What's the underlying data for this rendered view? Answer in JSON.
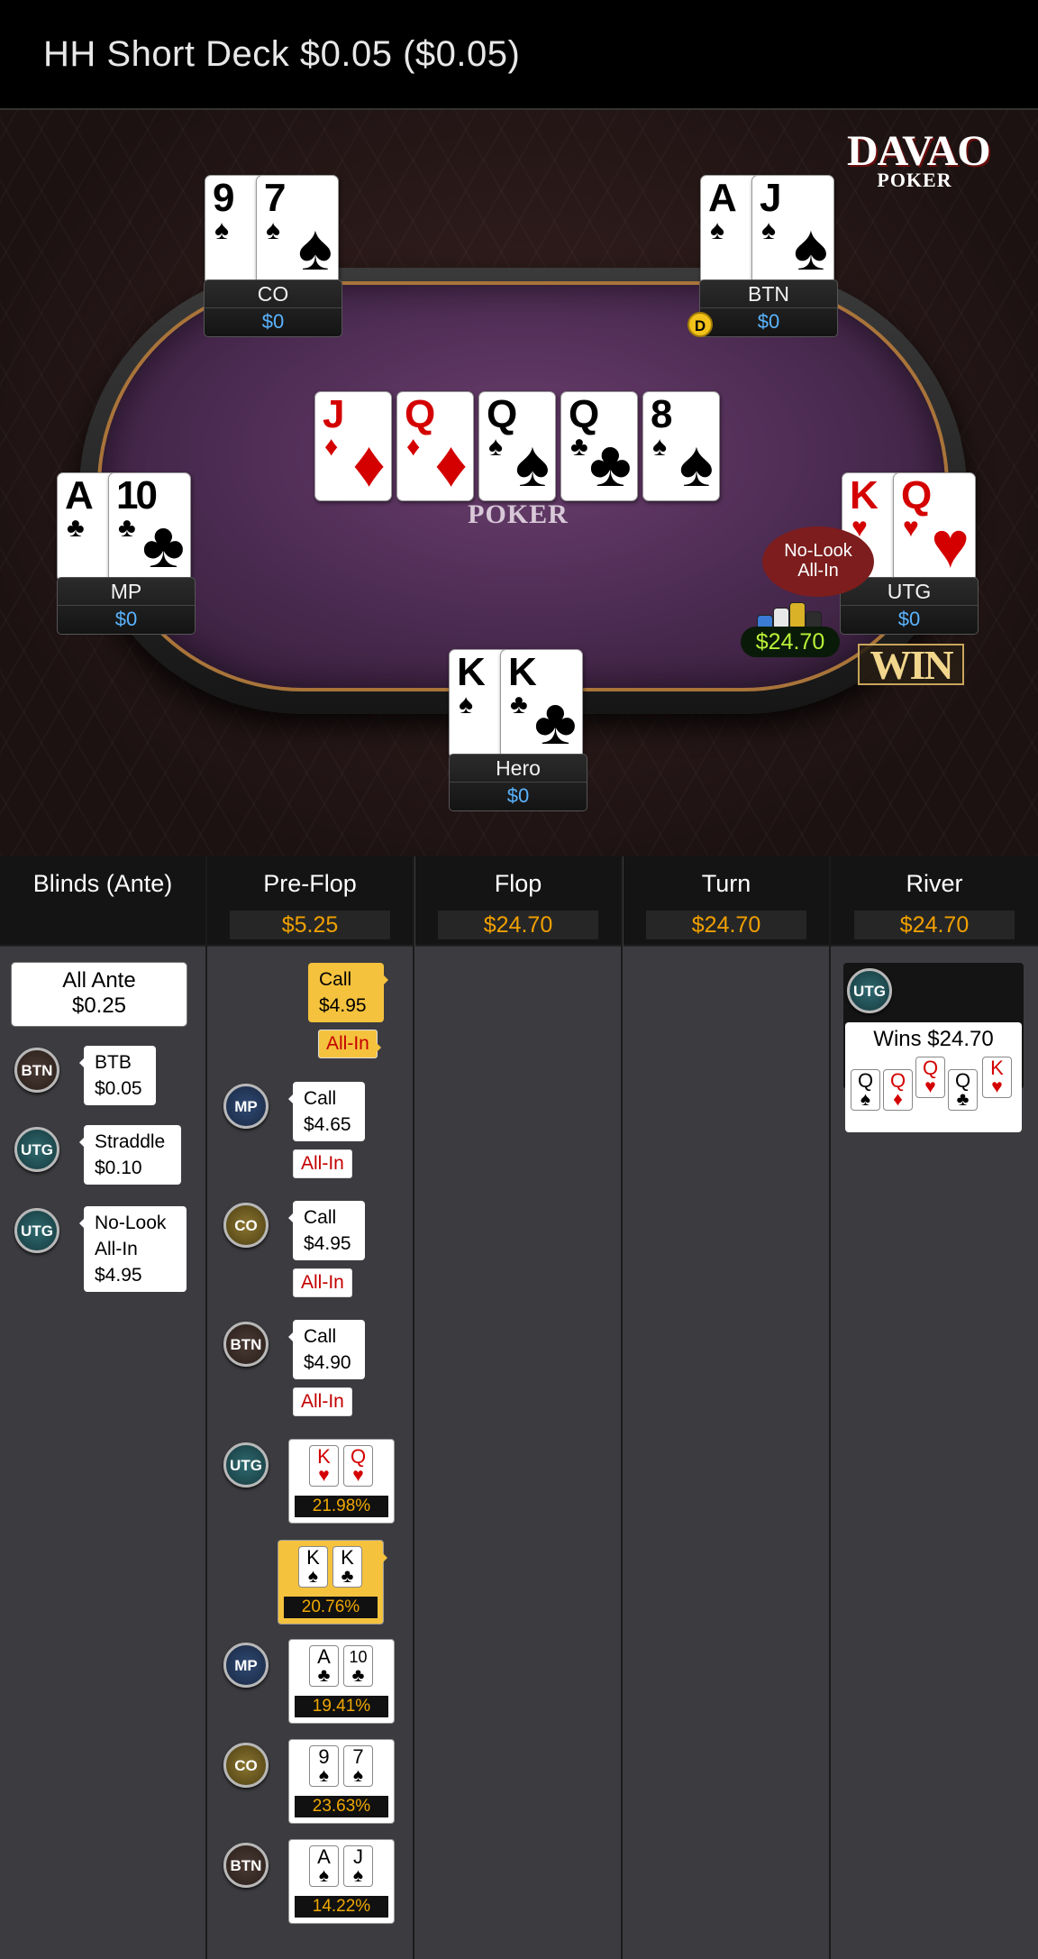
{
  "header": {
    "title": "HH  Short Deck $0.05 ($0.05)"
  },
  "brand": {
    "logo_main": "DAVAO",
    "logo_sub": "POKER",
    "felt_logo": "POKER"
  },
  "seats": {
    "co": {
      "name": "CO",
      "stack": "$0",
      "cards": [
        {
          "rank": "9",
          "suit": "♠"
        },
        {
          "rank": "7",
          "suit": "♠"
        }
      ]
    },
    "btn": {
      "name": "BTN",
      "stack": "$0",
      "dealer": "D",
      "cards": [
        {
          "rank": "A",
          "suit": "♠"
        },
        {
          "rank": "J",
          "suit": "♠"
        }
      ]
    },
    "mp": {
      "name": "MP",
      "stack": "$0",
      "cards": [
        {
          "rank": "A",
          "suit": "♣"
        },
        {
          "rank": "10",
          "suit": "♣"
        }
      ]
    },
    "utg": {
      "name": "UTG",
      "stack": "$0",
      "cards": [
        {
          "rank": "K",
          "suit": "♥"
        },
        {
          "rank": "Q",
          "suit": "♥"
        }
      ],
      "badge": "WIN"
    },
    "hero": {
      "name": "Hero",
      "stack": "$0",
      "cards": [
        {
          "rank": "K",
          "suit": "♠"
        },
        {
          "rank": "K",
          "suit": "♣"
        }
      ]
    }
  },
  "board": [
    {
      "rank": "J",
      "suit": "♦"
    },
    {
      "rank": "Q",
      "suit": "♦"
    },
    {
      "rank": "Q",
      "suit": "♠"
    },
    {
      "rank": "Q",
      "suit": "♣"
    },
    {
      "rank": "8",
      "suit": "♠"
    }
  ],
  "pot": {
    "bubble_line1": "No-Look",
    "bubble_line2": "All-In",
    "amount": "$24.70"
  },
  "streets": [
    {
      "label": "Blinds (Ante)",
      "pot": ""
    },
    {
      "label": "Pre-Flop",
      "pot": "$5.25"
    },
    {
      "label": "Flop",
      "pot": "$24.70"
    },
    {
      "label": "Turn",
      "pot": "$24.70"
    },
    {
      "label": "River",
      "pot": "$24.70"
    }
  ],
  "blinds": {
    "ante_line1": "All Ante",
    "ante_line2": "$0.25",
    "actions": [
      {
        "pos": "BTN",
        "line1": "BTB",
        "line2": "$0.05"
      },
      {
        "pos": "UTG",
        "line1": "Straddle",
        "line2": "$0.10"
      },
      {
        "pos": "UTG",
        "line1": "No-Look",
        "line2": "All-In",
        "line3": "$4.95"
      }
    ]
  },
  "preflop": {
    "actions": [
      {
        "pos": "",
        "line1": "Call",
        "line2": "$4.95",
        "allin": "All-In",
        "hero": true
      },
      {
        "pos": "MP",
        "line1": "Call",
        "line2": "$4.65",
        "allin": "All-In"
      },
      {
        "pos": "CO",
        "line1": "Call",
        "line2": "$4.95",
        "allin": "All-In"
      },
      {
        "pos": "BTN",
        "line1": "Call",
        "line2": "$4.90",
        "allin": "All-In"
      }
    ],
    "equities": [
      {
        "pos": "UTG",
        "cards": [
          {
            "rank": "K",
            "suit": "♥"
          },
          {
            "rank": "Q",
            "suit": "♥"
          }
        ],
        "pct": "21.98%"
      },
      {
        "pos": "",
        "cards": [
          {
            "rank": "K",
            "suit": "♠"
          },
          {
            "rank": "K",
            "suit": "♣"
          }
        ],
        "pct": "20.76%",
        "hero": true
      },
      {
        "pos": "MP",
        "cards": [
          {
            "rank": "A",
            "suit": "♣"
          },
          {
            "rank": "10",
            "suit": "♣"
          }
        ],
        "pct": "19.41%"
      },
      {
        "pos": "CO",
        "cards": [
          {
            "rank": "9",
            "suit": "♠"
          },
          {
            "rank": "7",
            "suit": "♠"
          }
        ],
        "pct": "23.63%"
      },
      {
        "pos": "BTN",
        "cards": [
          {
            "rank": "A",
            "suit": "♠"
          },
          {
            "rank": "J",
            "suit": "♠"
          }
        ],
        "pct": "14.22%"
      }
    ]
  },
  "river": {
    "pos": "UTG",
    "result": "Wins $24.70",
    "cards": [
      {
        "rank": "Q",
        "suit": "♠"
      },
      {
        "rank": "Q",
        "suit": "♦"
      },
      {
        "rank": "Q",
        "suit": "♥"
      },
      {
        "rank": "Q",
        "suit": "♣"
      },
      {
        "rank": "K",
        "suit": "♥"
      }
    ]
  },
  "colors": {
    "hearts": "#d40000",
    "diamonds": "#d40000",
    "spades": "#000000",
    "clubs": "#000000",
    "pot_text": "#f0a000",
    "stack_text": "#5ab4ff"
  }
}
